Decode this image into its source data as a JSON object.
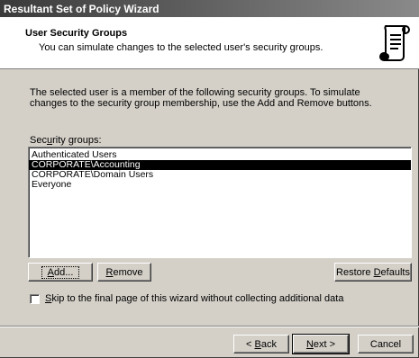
{
  "window": {
    "title": "Resultant Set of Policy Wizard"
  },
  "header": {
    "title": "User Security Groups",
    "subtitle": "You can simulate changes to the selected user's security groups.",
    "icon": "scroll-document-icon"
  },
  "description": "The selected user is a member of the following security groups. To simulate changes to the security group membership, use the Add and Remove buttons.",
  "security_groups": {
    "label_pre": "Sec",
    "label_mnemonic": "u",
    "label_post": "rity groups:",
    "items": [
      {
        "label": "Authenticated Users",
        "selected": false
      },
      {
        "label": "CORPORATE\\Accounting",
        "selected": true
      },
      {
        "label": "CORPORATE\\Domain Users",
        "selected": false
      },
      {
        "label": "Everyone",
        "selected": false
      }
    ]
  },
  "buttons": {
    "add": {
      "mnemonic": "A",
      "rest": "dd..."
    },
    "remove": {
      "mnemonic": "R",
      "rest": "emove"
    },
    "restore": {
      "pre": "Restore ",
      "mnemonic": "D",
      "rest": "efaults"
    },
    "back": {
      "pre": "< ",
      "mnemonic": "B",
      "rest": "ack"
    },
    "next": {
      "mnemonic": "N",
      "rest": "ext >"
    },
    "cancel": {
      "label": "Cancel"
    }
  },
  "skip_checkbox": {
    "checked": false,
    "mnemonic": "S",
    "rest": "kip to the final page of this wizard without collecting additional data"
  }
}
